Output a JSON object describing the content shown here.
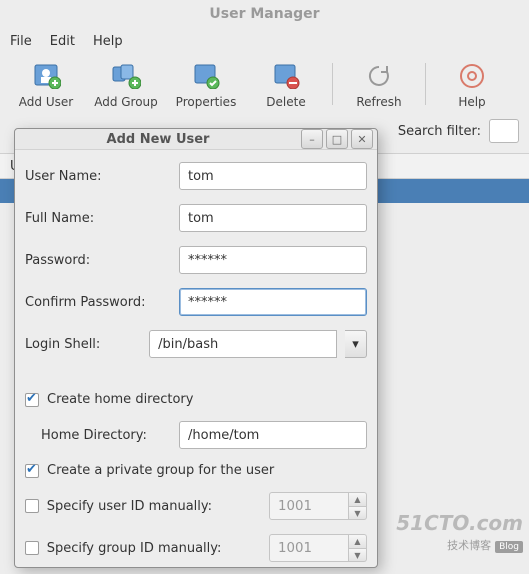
{
  "app": {
    "title": "User Manager"
  },
  "menu": {
    "file": "File",
    "edit": "Edit",
    "help": "Help"
  },
  "toolbar": {
    "add_user": "Add User",
    "add_group": "Add Group",
    "properties": "Properties",
    "delete": "Delete",
    "refresh": "Refresh",
    "help": "Help"
  },
  "search": {
    "label": "Search filter:",
    "value": ""
  },
  "dialog": {
    "title": "Add New User",
    "fields": {
      "user_name_label": "User Name:",
      "user_name_value": "tom",
      "full_name_label": "Full Name:",
      "full_name_value": "tom",
      "password_label": "Password:",
      "password_value": "******",
      "confirm_label": "Confirm Password:",
      "confirm_value": "******",
      "login_shell_label": "Login Shell:",
      "login_shell_value": "/bin/bash"
    },
    "opts": {
      "create_home": "Create home directory",
      "home_dir_label": "Home Directory:",
      "home_dir_value": "/home/tom",
      "private_group": "Create a private group for the user",
      "spec_uid": "Specify user ID manually:",
      "uid_value": "1001",
      "spec_gid": "Specify group ID manually:",
      "gid_value": "1001"
    }
  },
  "watermark": {
    "site": "51CTO.com",
    "sub": "技术博客",
    "badge": "Blog"
  }
}
